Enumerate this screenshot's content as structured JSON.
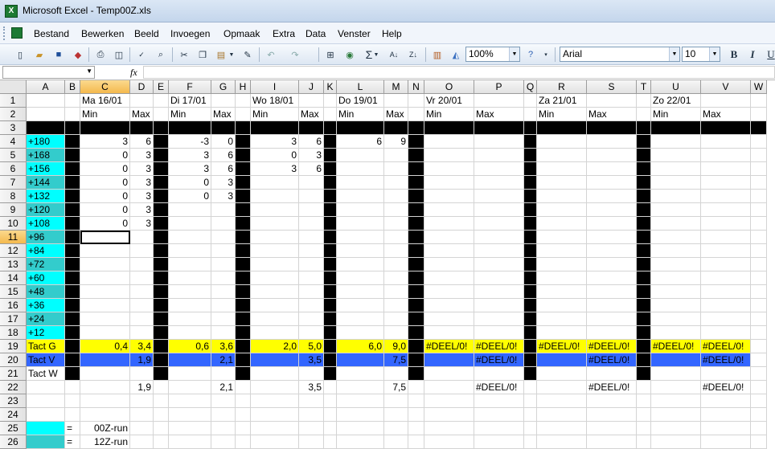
{
  "window": {
    "title": "Microsoft Excel - Temp00Z.xls",
    "icon": "excel-app-icon"
  },
  "menu": [
    "Bestand",
    "Bewerken",
    "Beeld",
    "Invoegen",
    "Opmaak",
    "Extra",
    "Data",
    "Venster",
    "Help"
  ],
  "toolbar": {
    "zoom": "100%",
    "font": "Arial",
    "size": "10",
    "bold_label": "B",
    "italic_label": "I",
    "underline_label": "U",
    "sum_label": "Σ",
    "sort_az_label": "A↓",
    "sort_za_label": "Z↓",
    "icons": [
      "new-icon",
      "open-icon",
      "save-icon",
      "permission-icon",
      "print-icon",
      "print-preview-icon",
      "spelling-icon",
      "research-icon",
      "cut-icon",
      "copy-icon",
      "paste-icon",
      "format-painter-icon",
      "undo-icon",
      "redo-icon",
      "hyperlink-icon",
      "insert-function-icon",
      "autosum-icon",
      "sort-ascending-icon",
      "sort-descending-icon",
      "chart-wizard-icon",
      "drawing-icon",
      "help-icon",
      "bold-icon",
      "italic-icon",
      "underline-icon"
    ]
  },
  "formula_bar": {
    "name_box": "",
    "fx": "fx",
    "formula": ""
  },
  "sheet": {
    "columns": [
      "A",
      "B",
      "C",
      "D",
      "E",
      "F",
      "G",
      "H",
      "I",
      "J",
      "K",
      "L",
      "M",
      "N",
      "O",
      "P",
      "Q",
      "R",
      "S",
      "T",
      "U",
      "V",
      "W"
    ],
    "rows": [
      "1",
      "2",
      "3",
      "4",
      "5",
      "6",
      "7",
      "8",
      "9",
      "10",
      "11",
      "12",
      "13",
      "14",
      "15",
      "16",
      "17",
      "18",
      "19",
      "20",
      "21",
      "22",
      "23",
      "24",
      "25",
      "26"
    ],
    "selected_cell": "C11",
    "colors": {
      "cyan": "#00ffff",
      "teal": "#33cccc",
      "yellow": "#ffff00",
      "blue": "#3366ff",
      "black": "#000000"
    },
    "cells": {
      "C1": "Ma 16/01",
      "C2": "Min",
      "D2": "Max",
      "F1": "Di 17/01",
      "F2": "Min",
      "G2": "Max",
      "I1": "Wo 18/01",
      "I2": "Min",
      "J2": "Max",
      "L1": "Do 19/01",
      "L2": "Min",
      "M2": "Max",
      "O1": "Vr 20/01",
      "O2": "Min",
      "P2": "Max",
      "R1": "Za 21/01",
      "R2": "Min",
      "S2": "Max",
      "U1": "Zo 22/01",
      "U2": "Min",
      "V2": "Max",
      "A4": "+180",
      "A5": "+168",
      "A6": "+156",
      "A7": "+144",
      "A8": "+132",
      "A9": "+120",
      "A10": "+108",
      "A11": "+96",
      "A12": "+84",
      "A13": "+72",
      "A14": "+60",
      "A15": "+48",
      "A16": "+36",
      "A17": "+24",
      "A18": "+12",
      "A19": "Tact G",
      "A20": "Tact V",
      "A21": "Tact W",
      "C4": "3",
      "D4": "6",
      "C5": "0",
      "D5": "3",
      "C6": "0",
      "D6": "3",
      "C7": "0",
      "D7": "3",
      "C8": "0",
      "D8": "3",
      "C9": "0",
      "D9": "3",
      "C10": "0",
      "D10": "3",
      "F4": "-3",
      "G4": "0",
      "F5": "3",
      "G5": "6",
      "F6": "3",
      "G6": "6",
      "F7": "0",
      "G7": "3",
      "F8": "0",
      "G8": "3",
      "I4": "3",
      "J4": "6",
      "I5": "0",
      "J5": "3",
      "I6": "3",
      "J6": "6",
      "L4": "6",
      "M4": "9",
      "C19": "0,4",
      "D19": "3,4",
      "F19": "0,6",
      "G19": "3,6",
      "I19": "2,0",
      "J19": "5,0",
      "L19": "6,0",
      "M19": "9,0",
      "O19": "#DEEL/0!",
      "P19": "#DEEL/0!",
      "R19": "#DEEL/0!",
      "S19": "#DEEL/0!",
      "U19": "#DEEL/0!",
      "V19": "#DEEL/0!",
      "D20": "1,9",
      "G20": "2,1",
      "J20": "3,5",
      "M20": "7,5",
      "P20": "#DEEL/0!",
      "S20": "#DEEL/0!",
      "V20": "#DEEL/0!",
      "D22": "1,9",
      "G22": "2,1",
      "J22": "3,5",
      "M22": "7,5",
      "P22": "#DEEL/0!",
      "S22": "#DEEL/0!",
      "V22": "#DEEL/0!",
      "B25": "=",
      "C25": "00Z-run",
      "B26": "=",
      "C26": "12Z-run"
    }
  }
}
